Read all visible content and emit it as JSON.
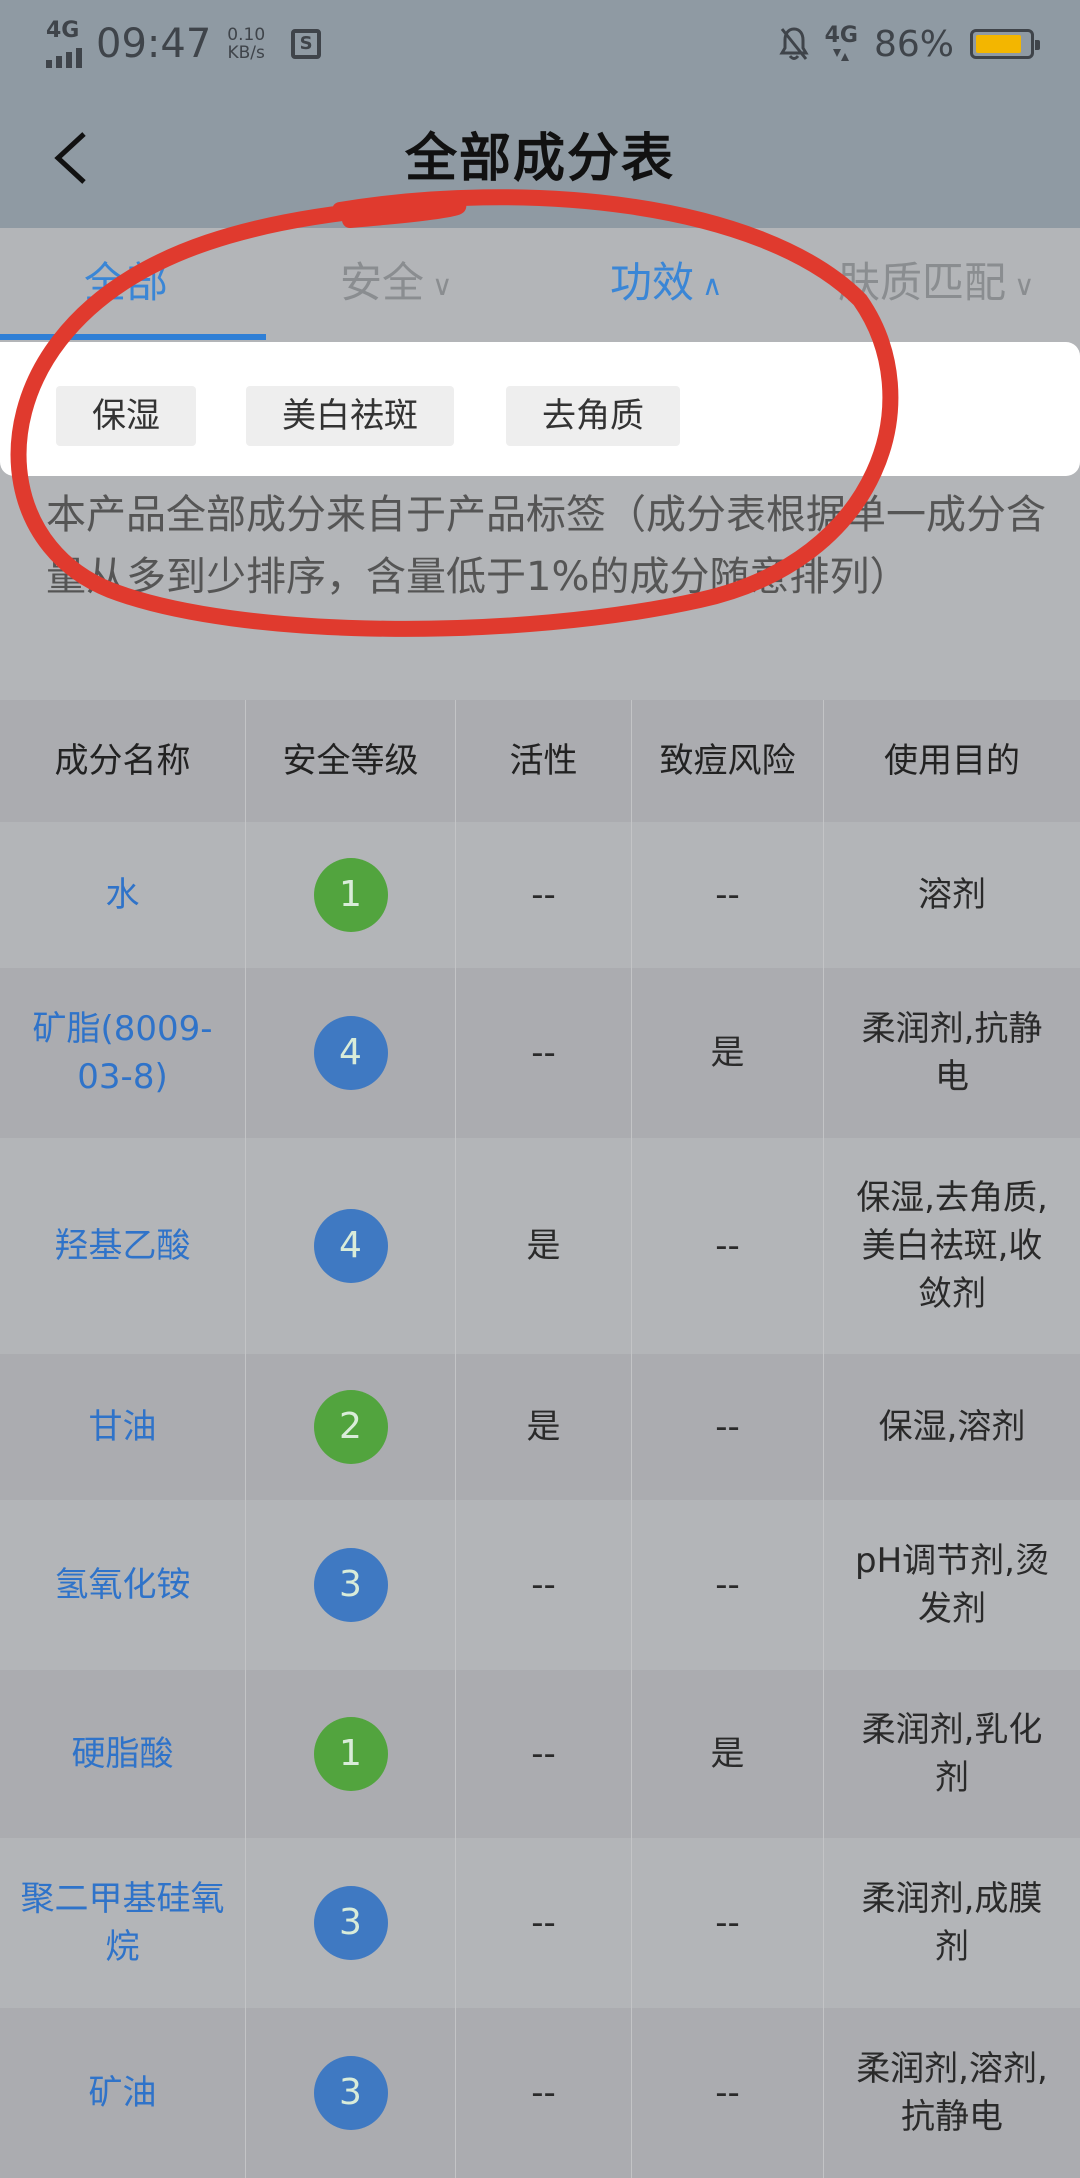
{
  "status_bar": {
    "network_left": "4G",
    "time": "09:47",
    "speed_value": "0.10",
    "speed_unit": "KB/s",
    "network_right": "4G",
    "battery": "86%",
    "battery_level": 0.86
  },
  "header": {
    "title": "全部成分表"
  },
  "tabs": [
    {
      "label": "全部",
      "active": true
    },
    {
      "label": "安全"
    },
    {
      "label": "功效"
    },
    {
      "label": "肤质匹配"
    }
  ],
  "filter": {
    "chips": [
      "保湿",
      "美白祛斑",
      "去角质"
    ]
  },
  "description": "本产品全部成分来自于产品标签（成分表根据单一成分含量从多到少排序，含量低于1%的成分随意排列）",
  "table": {
    "headers": [
      "成分名称",
      "安全等级",
      "活性",
      "致痘风险",
      "使用目的"
    ],
    "rows": [
      {
        "name": "水",
        "level": "1",
        "active": "--",
        "acne": "--",
        "purpose": "溶剂"
      },
      {
        "name": "矿脂(8009-03-8)",
        "level": "4",
        "active": "--",
        "acne": "是",
        "purpose": "柔润剂,抗静电"
      },
      {
        "name": "羟基乙酸",
        "level": "4",
        "active": "是",
        "acne": "--",
        "purpose": "保湿,去角质,美白祛斑,收敛剂"
      },
      {
        "name": "甘油",
        "level": "2",
        "active": "是",
        "acne": "--",
        "purpose": "保湿,溶剂"
      },
      {
        "name": "氢氧化铵",
        "level": "3",
        "active": "--",
        "acne": "--",
        "purpose": "pH调节剂,烫发剂"
      },
      {
        "name": "硬脂酸",
        "level": "1",
        "active": "--",
        "acne": "是",
        "purpose": "柔润剂,乳化剂"
      },
      {
        "name": "聚二甲基硅氧烷",
        "level": "3",
        "active": "--",
        "acne": "--",
        "purpose": "柔润剂,成膜剂"
      },
      {
        "name": "矿油",
        "level": "3",
        "active": "--",
        "acne": "--",
        "purpose": "柔润剂,溶剂,抗静电"
      }
    ]
  },
  "colors": {
    "accent": "#3a86d6",
    "level_green": "#52a43e",
    "level_blue": "#3f79c2",
    "annotation_red": "#e03a2e"
  }
}
